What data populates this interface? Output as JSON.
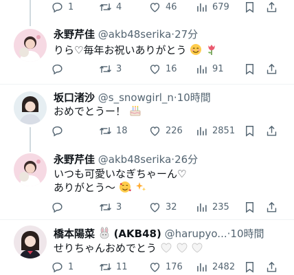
{
  "tweets": [
    {
      "id": "t0",
      "counts": {
        "reply": "1",
        "retweet": "4",
        "like": "46",
        "views": "679"
      }
    },
    {
      "id": "t1",
      "name": "永野芹佳",
      "handle": "@akb48serika",
      "dot": "·",
      "time": "27分",
      "lines": [
        "りら♡毎年お祝いありがとう"
      ],
      "emoji": [
        "smiling-face-icon",
        "tulip-icon"
      ],
      "counts": {
        "reply": "",
        "retweet": "3",
        "like": "16",
        "views": "91"
      }
    },
    {
      "id": "t2",
      "name": "坂口渚沙",
      "handle": "@s_snowgirl_n",
      "dot": "·",
      "time": "10時間",
      "lines": [
        "おめでとうー！"
      ],
      "emoji": [
        "birthday-cake-icon"
      ],
      "counts": {
        "reply": "",
        "retweet": "18",
        "like": "226",
        "views": "2851"
      }
    },
    {
      "id": "t3",
      "name": "永野芹佳",
      "handle": "@akb48serika",
      "dot": "·",
      "time": "26分",
      "lines": [
        "いつも可愛いなぎちゃーん♡",
        "ありがとう〜"
      ],
      "emoji": [
        "hearts-face-icon",
        "sparkles-icon"
      ],
      "counts": {
        "reply": "",
        "retweet": "3",
        "like": "32",
        "views": "235"
      }
    },
    {
      "id": "t4",
      "name": "橋本陽菜",
      "name_suffix": "(AKB48)",
      "handle": "@harupyo...",
      "dot": "·",
      "time": "10時間",
      "lines": [
        "せりちゃんおめでとう"
      ],
      "emoji": [
        "white-heart-icon",
        "white-heart-icon",
        "white-heart-icon"
      ],
      "counts": {
        "reply": "1",
        "retweet": "11",
        "like": "176",
        "views": "2482"
      }
    }
  ],
  "colors": {
    "text": "#0f1419",
    "muted": "#536471",
    "line": "#cfd9de",
    "divider": "#eff3f4"
  }
}
